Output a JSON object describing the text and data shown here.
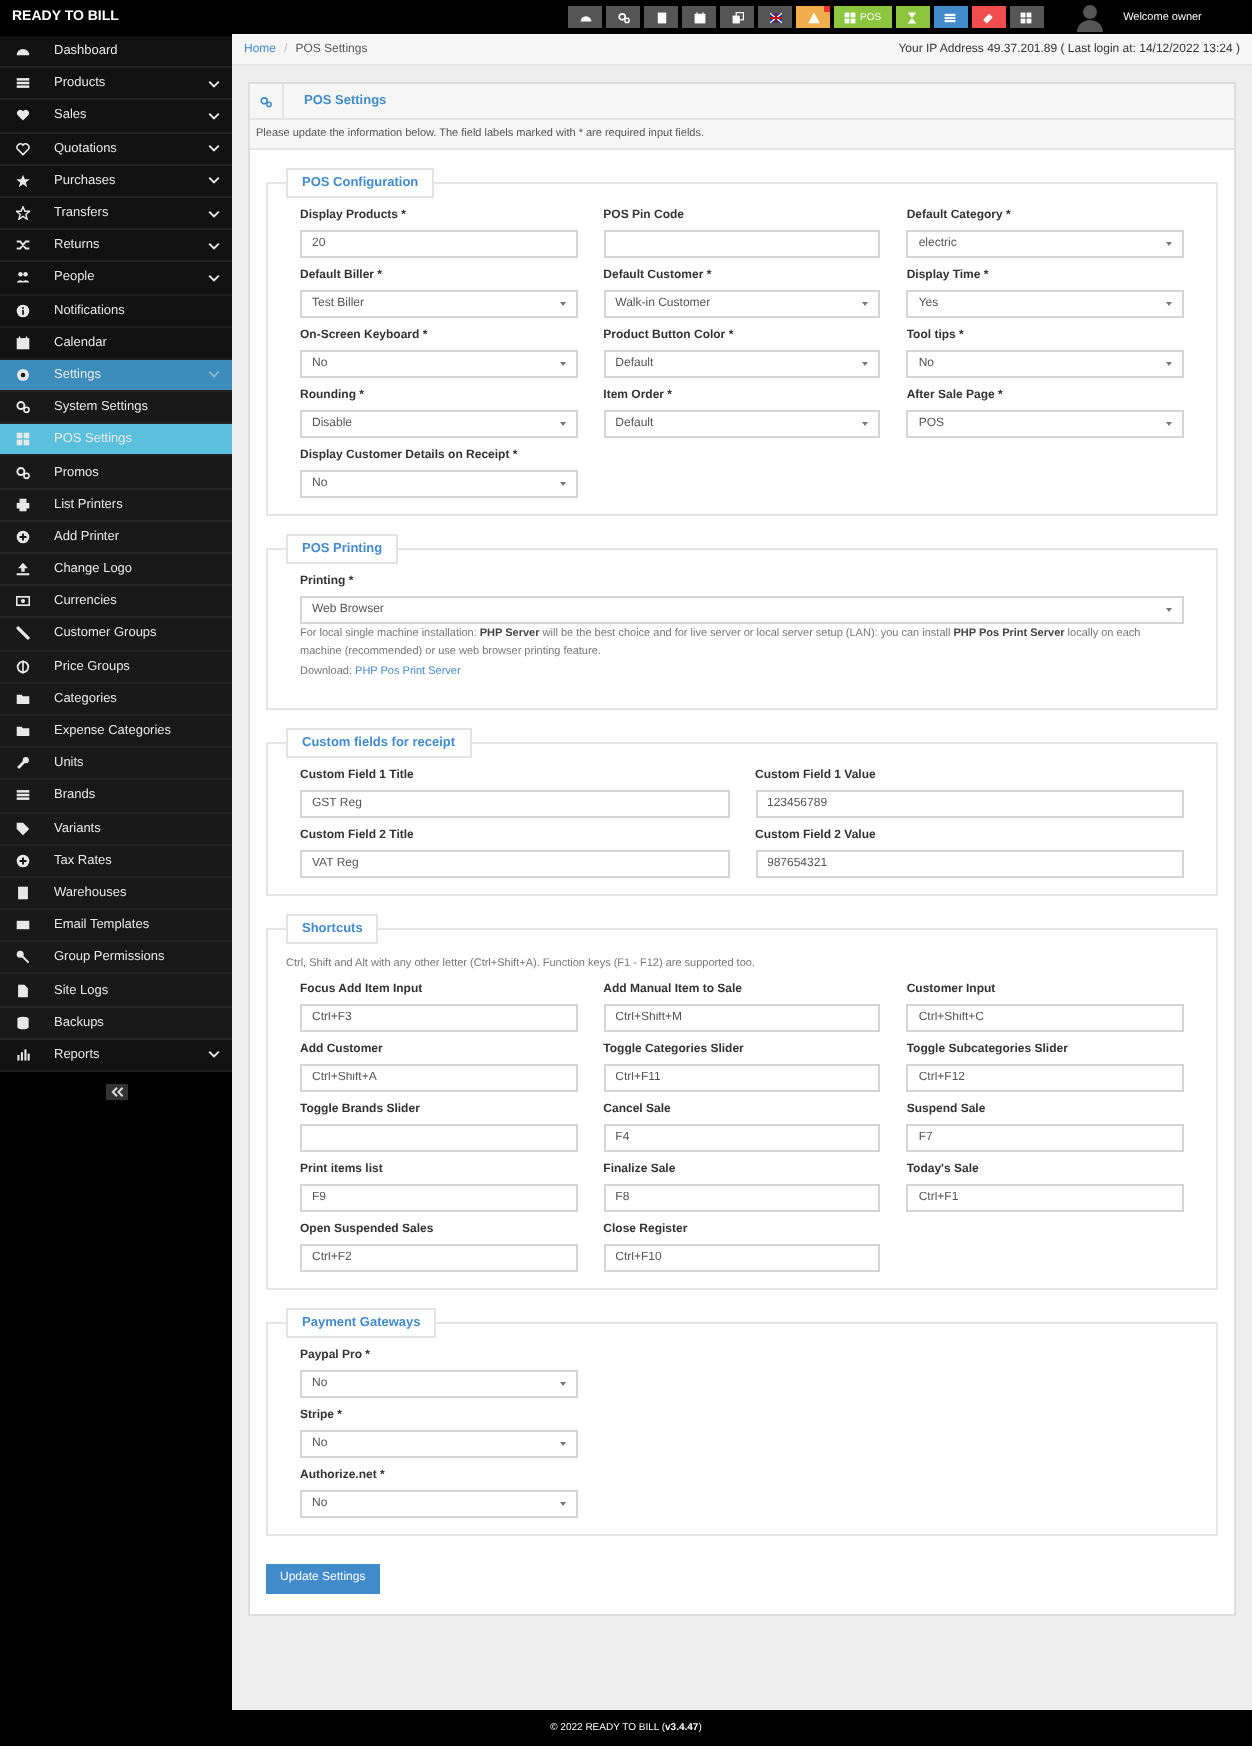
{
  "header": {
    "brand": "READY TO BILL",
    "buttons": [
      {
        "color": "#555555",
        "notification": false
      },
      {
        "color": "#555555",
        "notification": false
      },
      {
        "color": "#555555",
        "notification": false
      },
      {
        "color": "#555555",
        "notification": false
      },
      {
        "color": "#555555",
        "notification": false
      },
      {
        "color": "#555555",
        "notification": false
      },
      {
        "color": "#f0ad4e",
        "notification": true
      },
      {
        "color": "#8cc63f",
        "label": "POS",
        "notification": false
      },
      {
        "color": "#8cc63f",
        "notification": false
      },
      {
        "color": "#428bca",
        "notification": false
      },
      {
        "color": "#f04e4e",
        "notification": false
      },
      {
        "color": "#555555",
        "notification": false
      }
    ],
    "welcome": "Welcome owner"
  },
  "sidebar": {
    "items": [
      {
        "label": "Dashboard",
        "selected": false
      },
      {
        "label": "Products",
        "selected": false,
        "expanded": false
      },
      {
        "label": "Sales",
        "selected": false,
        "expanded": false
      },
      {
        "label": "Quotations",
        "selected": false,
        "expanded": false
      },
      {
        "label": "Purchases",
        "selected": false,
        "expanded": false
      },
      {
        "label": "Transfers",
        "selected": false,
        "expanded": false
      },
      {
        "label": "Returns",
        "selected": false,
        "expanded": false
      },
      {
        "label": "People",
        "selected": false,
        "expanded": false
      },
      {
        "label": "Notifications",
        "selected": false
      },
      {
        "label": "Calendar",
        "selected": false
      },
      {
        "label": "Settings",
        "selected": true,
        "expanded": true,
        "children": [
          {
            "label": "System Settings",
            "selected": false
          },
          {
            "label": "POS Settings",
            "selected": true
          },
          {
            "label": "Promos",
            "selected": false
          },
          {
            "label": "List Printers",
            "selected": false
          },
          {
            "label": "Add Printer",
            "selected": false
          },
          {
            "label": "Change Logo",
            "selected": false
          },
          {
            "label": "Currencies",
            "selected": false
          },
          {
            "label": "Customer Groups",
            "selected": false
          },
          {
            "label": "Price Groups",
            "selected": false
          },
          {
            "label": "Categories",
            "selected": false
          },
          {
            "label": "Expense Categories",
            "selected": false
          },
          {
            "label": "Units",
            "selected": false
          },
          {
            "label": "Brands",
            "selected": false
          },
          {
            "label": "Variants",
            "selected": false
          },
          {
            "label": "Tax Rates",
            "selected": false
          },
          {
            "label": "Warehouses",
            "selected": false
          },
          {
            "label": "Email Templates",
            "selected": false
          },
          {
            "label": "Group Permissions",
            "selected": false
          },
          {
            "label": "Site Logs",
            "selected": false
          },
          {
            "label": "Backups",
            "selected": false
          }
        ]
      },
      {
        "label": "Reports",
        "selected": false,
        "expanded": false
      }
    ]
  },
  "breadcrumb": {
    "link": "Home",
    "separator": "/",
    "current": "POS Settings",
    "login_info": "Your IP Address 49.37.201.89 ( Last login at: 14/12/2022 13:24 )"
  },
  "panel": {
    "title": "POS Settings",
    "intro": "Please update the information below. The field labels marked with * are required input fields.",
    "sections": [
      {
        "title": "POS Configuration",
        "kind": "grid3",
        "fields": [
          {
            "label": "Display Products *",
            "kind": "input",
            "value": "20"
          },
          {
            "label": "POS Pin Code",
            "kind": "input"
          },
          {
            "label": "Default Category *",
            "kind": "select",
            "value": "electric"
          },
          {
            "label": "Default Biller *",
            "kind": "select",
            "value": "Test Biller"
          },
          {
            "label": "Default Customer *",
            "kind": "select",
            "value": "Walk-in Customer"
          },
          {
            "label": "Display Time *",
            "kind": "select",
            "value": "Yes"
          },
          {
            "label": "On-Screen Keyboard *",
            "kind": "select",
            "value": "No"
          },
          {
            "label": "Product Button Color *",
            "kind": "select",
            "value": "Default"
          },
          {
            "label": "Tool tips *",
            "kind": "select",
            "value": "No"
          },
          {
            "label": "Rounding *",
            "kind": "select",
            "value": "Disable"
          },
          {
            "label": "Item Order *",
            "kind": "select",
            "value": "Default"
          },
          {
            "label": "After Sale Page *",
            "kind": "select",
            "value": "POS"
          },
          {
            "label": "Display Customer Details on Receipt *",
            "kind": "select",
            "value": "No"
          }
        ]
      },
      {
        "title": "POS Printing",
        "kind": "printing",
        "fields": [
          {
            "label": "Printing *",
            "kind": "select",
            "value": "Web Browser"
          }
        ],
        "note": "For local single machine installation: **PHP Server** will be the best choice and for live server or local server setup (LAN): you can install **PHP Pos Print Server** locally on each machine (recommended) or use web browser printing feature.",
        "download": {
          "label": "Download:",
          "link": "PHP Pos Print Server"
        }
      },
      {
        "title": "Custom fields for receipt",
        "kind": "grid2",
        "fields": [
          {
            "label": "Custom Field 1 Title",
            "kind": "input",
            "value": "GST Reg"
          },
          {
            "label": "Custom Field 1 Value",
            "kind": "input",
            "value": "123456789"
          },
          {
            "label": "Custom Field 2 Title",
            "kind": "input",
            "value": "VAT Reg"
          },
          {
            "label": "Custom Field 2 Value",
            "kind": "input",
            "value": "987654321"
          }
        ]
      },
      {
        "title": "Shortcuts",
        "kind": "grid3",
        "note": "Ctrl, Shift and Alt with any other letter (Ctrl+Shift+A). Function keys (F1 - F12) are supported too.",
        "fields": [
          {
            "label": "Focus Add Item Input",
            "kind": "input",
            "value": "Ctrl+F3"
          },
          {
            "label": "Add Manual Item to Sale",
            "kind": "input",
            "value": "Ctrl+Shift+M"
          },
          {
            "label": "Customer Input",
            "kind": "input",
            "value": "Ctrl+Shift+C"
          },
          {
            "label": "Add Customer",
            "kind": "input",
            "value": "Ctrl+Shift+A"
          },
          {
            "label": "Toggle Categories Slider",
            "kind": "input",
            "value": "Ctrl+F11"
          },
          {
            "label": "Toggle Subcategories Slider",
            "kind": "input",
            "value": "Ctrl+F12"
          },
          {
            "label": "Toggle Brands Slider",
            "kind": "input"
          },
          {
            "label": "Cancel Sale",
            "kind": "input",
            "value": "F4"
          },
          {
            "label": "Suspend Sale",
            "kind": "input",
            "value": "F7"
          },
          {
            "label": "Print items list",
            "kind": "input",
            "value": "F9"
          },
          {
            "label": "Finalize Sale",
            "kind": "input",
            "value": "F8"
          },
          {
            "label": "Today's Sale",
            "kind": "input",
            "value": "Ctrl+F1"
          },
          {
            "label": "Open Suspended Sales",
            "kind": "input",
            "value": "Ctrl+F2"
          },
          {
            "label": "Close Register",
            "kind": "input",
            "value": "Ctrl+F10"
          }
        ]
      },
      {
        "title": "Payment Gateways",
        "kind": "grid1",
        "fields": [
          {
            "label": "Paypal Pro *",
            "kind": "select",
            "value": "No"
          },
          {
            "label": "Stripe *",
            "kind": "select",
            "value": "No"
          },
          {
            "label": "Authorize.net *",
            "kind": "select",
            "value": "No"
          }
        ]
      }
    ],
    "submit": "Update Settings"
  },
  "footer": "© 2022 READY TO BILL (**v3.4.47**)"
}
